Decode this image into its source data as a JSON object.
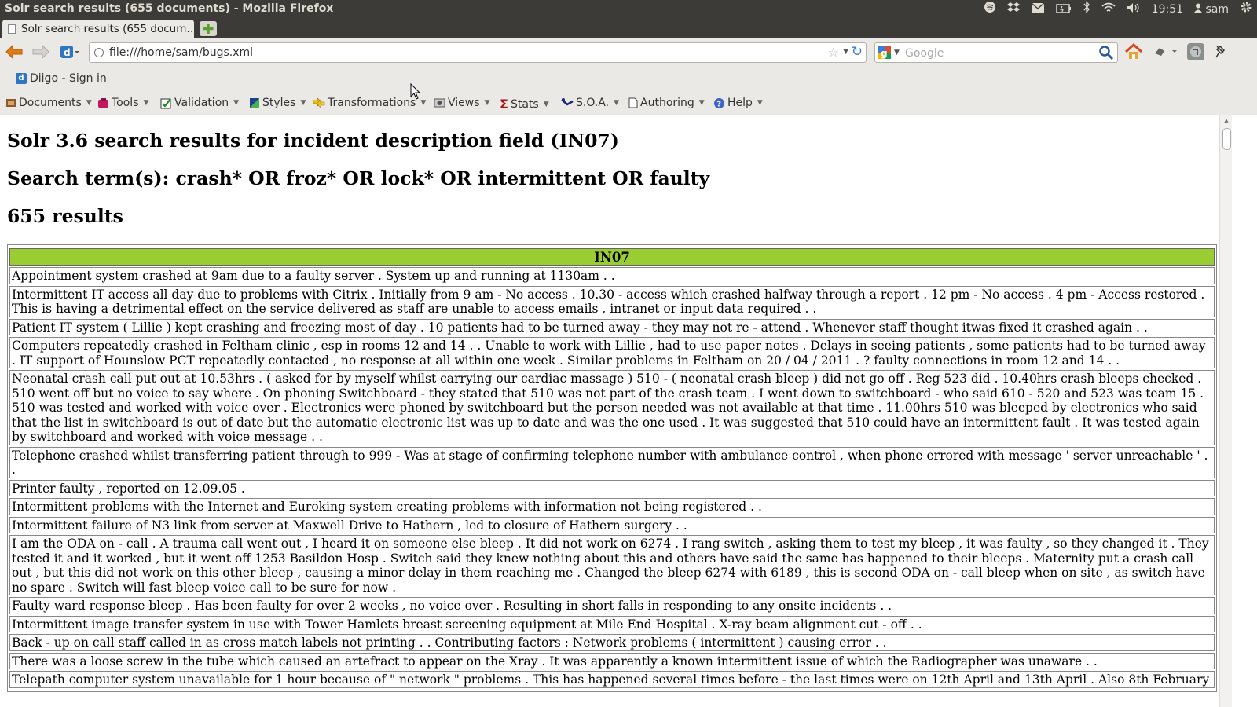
{
  "window": {
    "title": "Solr search results (655 documents) - Mozilla Firefox",
    "clock": "19:51",
    "user": "sam",
    "tray_icons": [
      "spotify-icon",
      "dropbox-icon",
      "mail-icon",
      "battery-icon",
      "bluetooth-icon",
      "wifi-icon",
      "volume-icon",
      "user-icon",
      "settings-gear-icon"
    ]
  },
  "tabs": [
    {
      "label": "Solr search results (655 docum…",
      "active": true
    }
  ],
  "navbar": {
    "url": "file:///home/sam/bugs.xml",
    "search_placeholder": "Google"
  },
  "bookmarks": [
    {
      "label": "Diigo - Sign in"
    }
  ],
  "toolbar": {
    "items": [
      {
        "label": "Documents"
      },
      {
        "label": "Tools"
      },
      {
        "label": "Validation"
      },
      {
        "label": "Styles"
      },
      {
        "label": "Transformations"
      },
      {
        "label": "Views"
      },
      {
        "label": "Stats"
      },
      {
        "label": "S.O.A."
      },
      {
        "label": "Authoring"
      },
      {
        "label": "Help"
      }
    ]
  },
  "page": {
    "heading1": "Solr 3.6 search results for incident description field (IN07)",
    "heading2": "Search term(s): crash* OR froz* OR lock* OR intermittent OR faulty",
    "heading3": "655 results",
    "table": {
      "header": "IN07",
      "rows": [
        "Appointment system crashed at 9am due to a faulty server . System up and running at 1130am . .",
        "Intermittent IT access all day due to problems with Citrix . Initially from 9 am - No access . 10.30 - access which crashed halfway through a report . 12 pm - No access . 4 pm - Access restored . This is having a detrimental effect on the service delivered as staff are unable to access emails , intranet or input data required . .",
        "Patient IT system ( Lillie ) kept crashing and freezing most of day . 10 patients had to be turned away - they may not re - attend . Whenever staff thought itwas fixed it crashed again . .",
        "Computers repeatedly crashed in Feltham clinic , esp in rooms 12 and 14 . . Unable to work with Lillie , had to use paper notes . Delays in seeing patients , some patients had to be turned away . IT support of Hounslow PCT repeatedly contacted , no response at all within one week . Similar problems in Feltham on 20 / 04 / 2011 . ? faulty connections in room 12 and 14 . .",
        "Neonatal crash call put out at 10.53hrs . ( asked for by myself whilst carrying our cardiac massage ) 510 - ( neonatal crash bleep ) did not go off . Reg 523 did . 10.40hrs crash bleeps checked . 510 went off but no voice to say where . On phoning Switchboard - they stated that 510 was not part of the crash team . I went down to switchboard - who said 610 - 520 and 523 was team 15 . 510 was tested and worked with voice over . Electronics were phoned by switchboard but the person needed was not available at that time . 11.00hrs 510 was bleeped by electronics who said that the list in switchboard is out of date but the automatic electronic list was up to date and was the one used . It was suggested that 510 could have an intermittent fault . It was tested again by switchboard and worked with voice message . .",
        "Telephone crashed whilst transferring patient through to 999 - Was at stage of confirming telephone number with ambulance control , when phone errored with message ' server unreachable ' . .",
        "Printer faulty , reported on 12.09.05 .",
        "Intermittent problems with the Internet and Euroking system creating problems with information not being registered . .",
        "Intermittent failure of N3 link from server at Maxwell Drive to Hathern , led to closure of Hathern surgery . .",
        "I am the ODA on - call . A trauma call went out , I heard it on someone else bleep . It did not work on 6274 . I rang switch , asking them to test my bleep , it was faulty , so they changed it . They tested it and it worked , but it went off 1253 Basildon Hosp . Switch said they knew nothing about this and others have said the same has happened to their bleeps . Maternity put a crash call out , but this did not work on this other bleep , causing a minor delay in them reaching me . Changed the bleep 6274 with 6189 , this is second ODA on - call bleep when on site , as switch have no spare . Switch will fast bleep voice call to be sure for now .",
        "Faulty ward response bleep . Has been faulty for over 2 weeks , no voice over . Resulting in short falls in responding to any onsite incidents . .",
        "Intermittent image transfer system in use with Tower Hamlets breast screening equipment at Mile End Hospital . X-ray beam alignment cut - off . .",
        "Back - up on call staff called in as cross match labels not printing . . Contributing factors : Network problems ( intermittent ) causing error . .",
        "There was a loose screw in the tube which caused an artefract to appear on the Xray . It was apparently a known intermittent issue of which the Radiographer was unaware . .",
        "Telepath computer system unavailable for 1 hour because of \" network \" problems . This has happened several times before - the last times were on 12th April and 13th April . Also 8th February"
      ]
    }
  }
}
